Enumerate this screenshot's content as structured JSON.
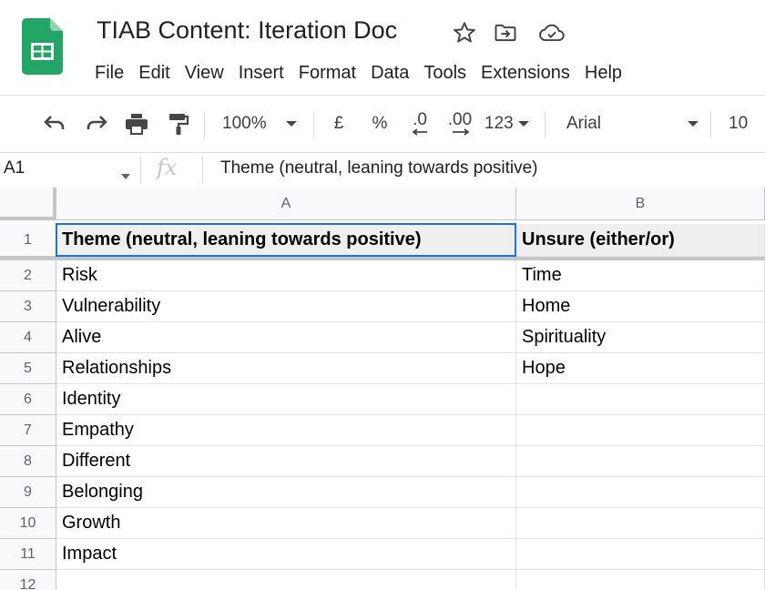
{
  "app": {
    "title": "TIAB Content: Iteration Doc",
    "icons": [
      "sheets-logo",
      "star-icon",
      "move-to-folder-icon",
      "cloud-saved-icon"
    ]
  },
  "menu": [
    "File",
    "Edit",
    "View",
    "Insert",
    "Format",
    "Data",
    "Tools",
    "Extensions",
    "Help"
  ],
  "toolbar": {
    "zoom": "100%",
    "currency": "£",
    "percent": "%",
    "decrease_decimal": ".0",
    "increase_decimal": ".00",
    "more_formats": "123",
    "font": "Arial",
    "font_size": "10",
    "icons": [
      "undo-icon",
      "redo-icon",
      "print-icon",
      "paint-format-icon",
      "chevron-down-icon"
    ]
  },
  "formula_bar": {
    "name_box": "A1",
    "fx": "fx",
    "content": "Theme (neutral, leaning towards positive)"
  },
  "sheet": {
    "columns": [
      "A",
      "B"
    ],
    "rows": [
      "1",
      "2",
      "3",
      "4",
      "5",
      "6",
      "7",
      "8",
      "9",
      "10",
      "11",
      "12"
    ],
    "cells": [
      [
        "Theme (neutral, leaning towards positive)",
        "Unsure (either/or)"
      ],
      [
        "Risk",
        "Time"
      ],
      [
        "Vulnerability",
        "Home"
      ],
      [
        "Alive",
        "Spirituality"
      ],
      [
        "Relationships",
        "Hope"
      ],
      [
        "Identity",
        ""
      ],
      [
        "Empathy",
        ""
      ],
      [
        "Different",
        ""
      ],
      [
        "Belonging",
        ""
      ],
      [
        "Growth",
        ""
      ],
      [
        "Impact",
        ""
      ],
      [
        "",
        ""
      ]
    ],
    "selected_cell": "A1"
  },
  "colors": {
    "sheets_green": "#23A566",
    "selection_blue": "#1A73E8",
    "header_bg": "#F8F9FA"
  }
}
